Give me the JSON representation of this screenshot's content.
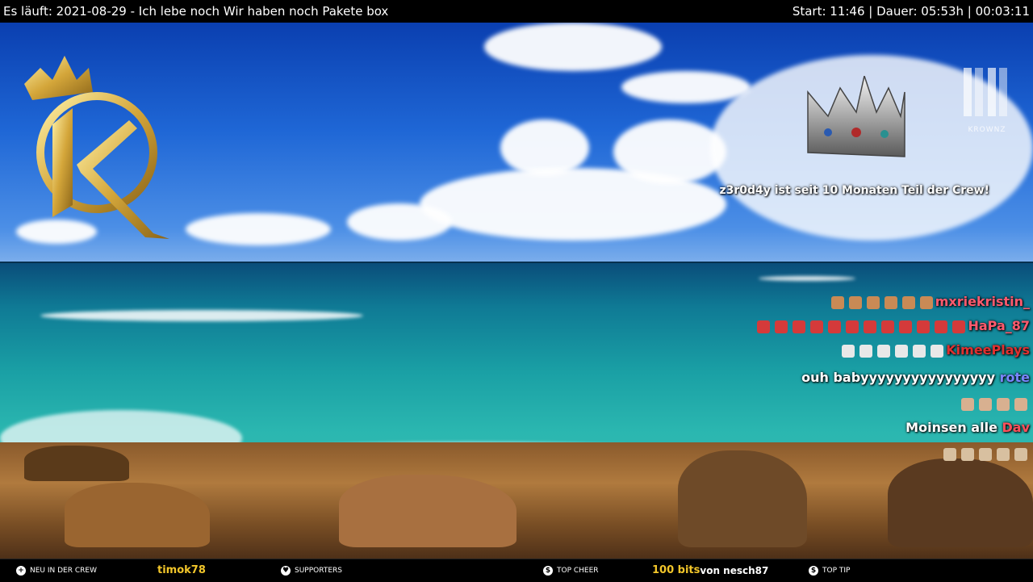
{
  "topbar": {
    "left": "Es läuft: 2021-08-29 - Ich lebe noch Wir haben noch Pakete box",
    "right": "Start: 11:46 | Dauer: 05:53h | 00:03:11"
  },
  "overlay": {
    "krownz_label": "KROWNZ",
    "alert_user": "z3r0d4y",
    "alert_text_1": " ist seit ",
    "alert_number": "10",
    "alert_text_2": " Monaten Teil der Crew!"
  },
  "chat": [
    {
      "user": "mxriekristin_",
      "text": "",
      "emote_count": 6,
      "emote_color": "#c98a55",
      "user_color": "#ff5a6e"
    },
    {
      "user": "HaPa_87",
      "text": "",
      "emote_count": 12,
      "emote_color": "#d43a3a",
      "user_color": "#ff5a6e"
    },
    {
      "user": "KimeePlays",
      "text": "",
      "emote_count": 6,
      "emote_color": "#e8e8e8",
      "user_color": "#e03030"
    },
    {
      "user": "rote",
      "text": "ouh babyyyyyyyyyyyyyyyy",
      "emote_count": 0,
      "emote_color": "",
      "user_color": "#7a86ff"
    },
    {
      "user": "",
      "text": "",
      "emote_count": 4,
      "emote_color": "#d8b090",
      "user_color": "#ffffff"
    },
    {
      "user": "Dav",
      "text": "Moinsen alle",
      "emote_count": 0,
      "emote_color": "",
      "user_color": "#ff4f5a"
    },
    {
      "user": "",
      "text": "",
      "emote_count": 5,
      "emote_color": "#d8c0a0",
      "user_color": "#ffffff"
    }
  ],
  "bottombar": {
    "new_crew_label": "NEU IN DER CREW",
    "new_crew_value": "timok78",
    "supporters_label": "SUPPORTERS",
    "top_cheer_label": "TOP CHEER",
    "top_cheer_amount": "100 bits",
    "top_cheer_rest": " von nesch87",
    "top_tip_label": "TOP TIP"
  },
  "colors": {
    "accent_gold": "#f2c62a",
    "bar_bg": "#000000"
  },
  "icons": [
    "plus-icon",
    "heart-icon",
    "dollar-icon",
    "dollar-icon"
  ]
}
